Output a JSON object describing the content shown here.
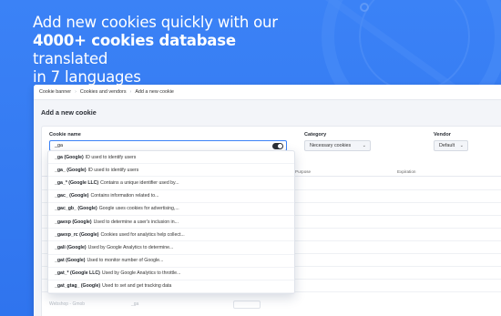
{
  "headline": {
    "line1": "Add new cookies quickly with our",
    "bold": "4000+ cookies database",
    "line2_rest": " translated",
    "line3": "in 7 languages"
  },
  "breadcrumb": [
    "Cookie banner",
    "Cookies and vendors",
    "Add a new cookie"
  ],
  "page_title": "Add a new cookie",
  "form": {
    "cookie_name_label": "Cookie name",
    "cookie_name_value": "_ga",
    "category_label": "Category",
    "category_value": "Necessary cookies",
    "vendor_label": "Vendor",
    "vendor_value": "Default"
  },
  "table": {
    "columns": [
      "Purpose",
      "Expiration"
    ]
  },
  "suggestions": [
    {
      "name": "_ga (Google)",
      "desc": "ID used to identify users"
    },
    {
      "name": "_ga_ (Google)",
      "desc": "ID used to identify users"
    },
    {
      "name": "_ga_* (Google LLC)",
      "desc": "Contains a unique identifier used by..."
    },
    {
      "name": "_gac_ (Google)",
      "desc": "Contains information related to..."
    },
    {
      "name": "_gac_gb_ (Google)",
      "desc": "Google uses cookies for advertising,..."
    },
    {
      "name": "_gaexp (Google)",
      "desc": "Used to determine a user's inclusion in..."
    },
    {
      "name": "_gaexp_rc (Google)",
      "desc": "Cookies used for analytics help collect..."
    },
    {
      "name": "_gali (Google)",
      "desc": "Used by Google Analytics to determine..."
    },
    {
      "name": "_gat (Google)",
      "desc": "Used to monitor number of Google..."
    },
    {
      "name": "_gat_* (Google LLC)",
      "desc": "Used by Google Analytics to throttle..."
    },
    {
      "name": "_gat_gtag_ (Google)",
      "desc": "Used to set and get tracking data"
    }
  ],
  "bottom_row": {
    "name": "Webshop - Gmob",
    "value": "_ga"
  },
  "colors": {
    "background": "#3b82f6",
    "accent": "#3b82f6"
  }
}
